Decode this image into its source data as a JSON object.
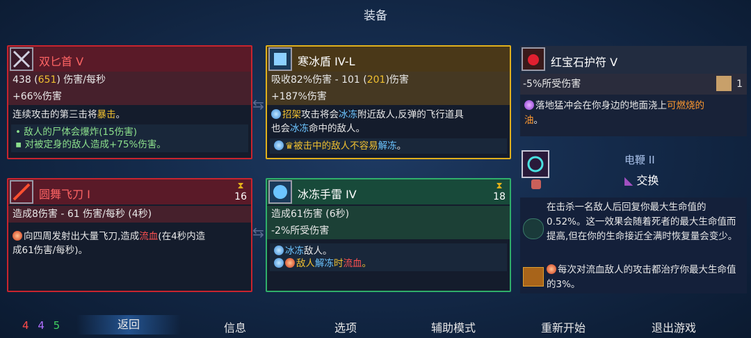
{
  "title": "装备",
  "colors": {
    "red": "#c8242e",
    "gold": "#e0b01c",
    "green": "#2fae6a",
    "highlight_yellow": "#f0c030"
  },
  "weapons": {
    "primary": {
      "name": "双匕首 V",
      "icon": "twin-daggers-icon",
      "stat_pre": "438 (",
      "stat_hl": "651",
      "stat_post": ") 伤害/每秒",
      "bonus": "+66%伤害",
      "desc_pre": "连续攻击的第三击将",
      "desc_hl": "暴击",
      "desc_post": "。",
      "affix1": "敌人的尸体会爆炸(15伤害)",
      "affix2": "对被定身的敌人造成+75%伤害。"
    },
    "shield": {
      "name": "寒冰盾 IV-L",
      "icon": "ice-shield-icon",
      "stat_pre": "吸收82%伤害 - 101 (",
      "stat_hl": "201",
      "stat_post": ")伤害",
      "bonus": "+187%伤害",
      "desc_a": "招架",
      "desc_b": "攻击将会",
      "desc_c": "冰冻",
      "desc_d": "附近敌人,反弹的飞行道具",
      "desc_e": "也会",
      "desc_f": "冰冻",
      "desc_g": "命中的敌人。",
      "affix_a": "被击中的敌人不容易",
      "affix_b": "解冻",
      "affix_c": "。"
    },
    "skill1": {
      "name": "圆舞飞刀 I",
      "icon": "throwing-knives-icon",
      "timer": "16",
      "stat": "造成8伤害 - 61 伤害/每秒 (4秒)",
      "desc_a": "向四周发射出大量飞刀,造成",
      "desc_b": "流血",
      "desc_c": "(在4秒内造",
      "desc_d": "成61伤害/每秒)。"
    },
    "skill2": {
      "name": "冰冻手雷 IV",
      "icon": "ice-grenade-icon",
      "timer": "18",
      "stat1": "造成61伤害 (6秒)",
      "stat2": "-2%所受伤害",
      "affix1_a": "冰冻",
      "affix1_b": "敌人。",
      "affix2_a": "敌人",
      "affix2_b": "解冻",
      "affix2_c": "时",
      "affix2_d": "流血",
      "affix2_e": "。"
    }
  },
  "amulet": {
    "name": "红宝石护符 V",
    "icon": "ruby-amulet-icon",
    "stat": "-5%所受伤害",
    "scroll_count": "1",
    "desc_a": "落地猛冲会在你身边的地面浇上",
    "desc_b": "可燃烧的",
    "desc_c": "油",
    "desc_d": "。"
  },
  "mutation_swap": {
    "name": "电鞭 II",
    "icon": "electric-whip-icon",
    "action": "交换"
  },
  "mutations": {
    "m1": "在击杀一名敌人后回复你最大生命值的0.52%。这一效果会随着死者的最大生命值而提高,但在你的生命接近全满时恢复量会变少。",
    "m2": "每次对流血敌人的攻击都治疗你最大生命值的3%。"
  },
  "stats": {
    "brutality": "4",
    "tactics": "4",
    "survival": "5"
  },
  "nav": [
    "返回",
    "信息",
    "选项",
    "辅助模式",
    "重新开始",
    "退出游戏"
  ]
}
